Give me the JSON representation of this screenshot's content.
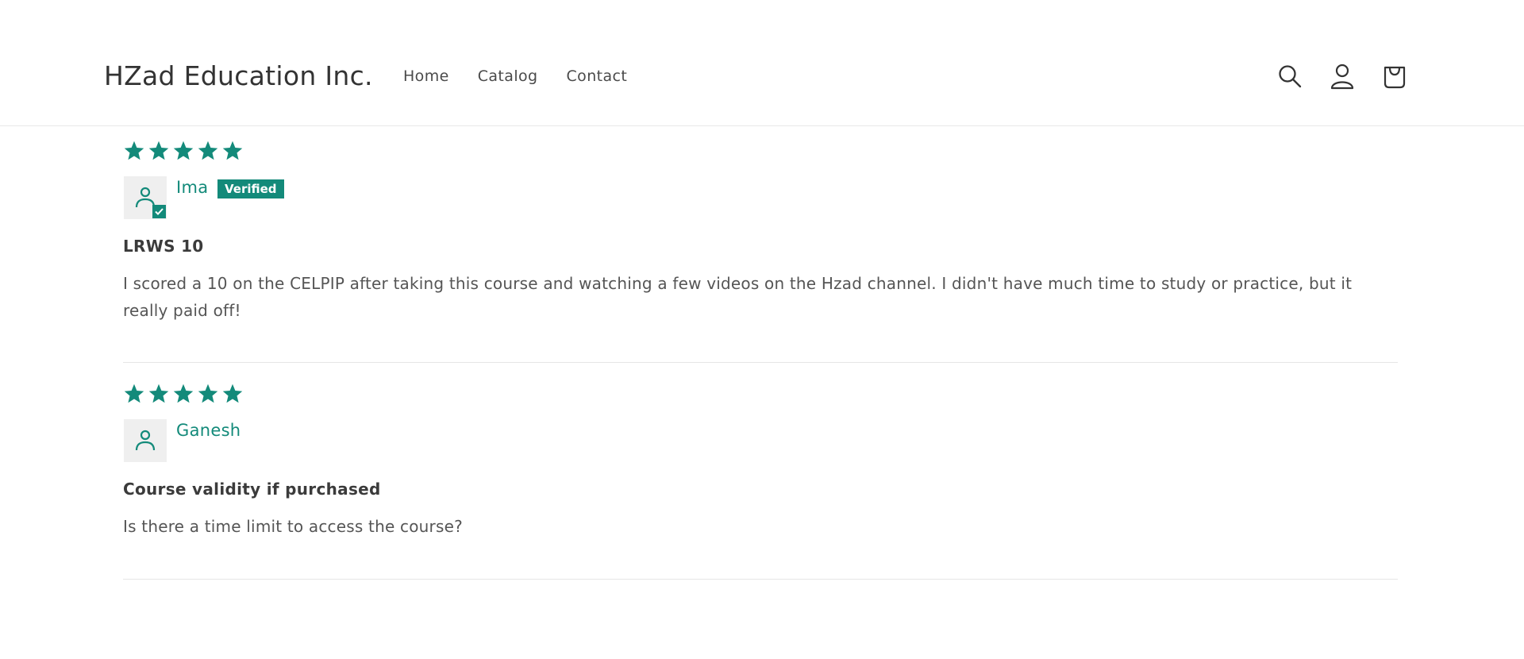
{
  "header": {
    "brand": "HZad Education Inc.",
    "nav": [
      {
        "label": "Home"
      },
      {
        "label": "Catalog"
      },
      {
        "label": "Contact"
      }
    ],
    "icons": [
      "search-icon",
      "account-icon",
      "cart-icon"
    ]
  },
  "colors": {
    "accent": "#138a7a",
    "avatar_bg": "#efefef",
    "divider": "#e6e6e6"
  },
  "reviews": [
    {
      "rating": 5,
      "author": "Ima",
      "verified_label": "Verified",
      "title": "LRWS 10",
      "body": "I scored a 10 on the CELPIP after taking this course and watching a few videos on the Hzad channel. I didn't have much time to study or practice, but it really paid off!"
    },
    {
      "rating": 5,
      "author": "Ganesh",
      "title": "Course validity if purchased",
      "body": "Is there a time limit to access the course?"
    }
  ]
}
